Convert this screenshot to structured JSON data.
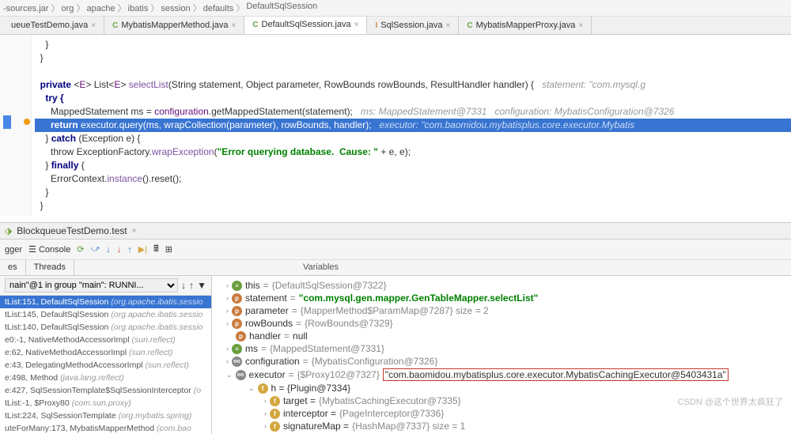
{
  "breadcrumb": [
    "-sources.jar",
    "org",
    "apache",
    "ibatis",
    "session",
    "defaults",
    "DefaultSqlSession"
  ],
  "tabs": [
    {
      "label": "ueueTestDemo.java",
      "iconClass": "",
      "active": false
    },
    {
      "label": "MybatisMapperMethod.java",
      "icon": "C",
      "iconClass": "",
      "active": false
    },
    {
      "label": "DefaultSqlSession.java",
      "icon": "C",
      "iconClass": "",
      "active": true
    },
    {
      "label": "SqlSession.java",
      "icon": "I",
      "iconClass": "orange",
      "active": false
    },
    {
      "label": "MybatisMapperProxy.java",
      "icon": "C",
      "iconClass": "",
      "active": false
    }
  ],
  "code": {
    "l1": "    }",
    "l2": "  }",
    "l3": "",
    "l4_pre": "  private <E> List<E> ",
    "l4_method": "selectList",
    "l4_args": "(String statement, Object parameter, RowBounds rowBounds, ResultHandler handler) {   ",
    "l4_com": "statement: \"com.mysql.g",
    "l5": "    try {",
    "l6_a": "      MappedStatement ms = ",
    "l6_b": "configuration",
    "l6_c": ".getMappedStatement(statement);   ",
    "l6_com": "ms: MappedStatement@7331   configuration: MybatisConfiguration@7326",
    "l7_a": "      return ",
    "l7_b": "executor",
    "l7_c": ".query(ms, ",
    "l7_d": "wrapCollection",
    "l7_e": "(parameter), rowBounds, handler);   ",
    "l7_com": "executor: \"com.baomidou.mybatisplus.core.executor.Mybatis",
    "l8_a": "    } ",
    "l8_b": "catch",
    "l8_c": " (Exception e) {",
    "l9_a": "      throw ExceptionFactory.",
    "l9_b": "wrapException",
    "l9_c": "(",
    "l9_str": "\"Error querying database.  Cause: \"",
    "l9_d": " + e, e);",
    "l10a": "    } ",
    "l10b": "finally",
    "l10c": " {",
    "l11_a": "      ErrorContext.",
    "l11_b": "instance",
    "l11_c": "().reset();",
    "l12": "    }",
    "l13": "  }"
  },
  "debugSession": "BlockqueueTestDemo.test",
  "debugTool": {
    "gger": "gger",
    "console": "Console"
  },
  "framesTabs": [
    "es",
    "Threads"
  ],
  "frameDropdown": "nain\"@1 in group \"main\": RUNNI...",
  "frames": [
    {
      "text": "tList:151, DefaultSqlSession ",
      "tail": "(org.apache.ibatis.sessio",
      "selected": true
    },
    {
      "text": "tList:145, DefaultSqlSession ",
      "tail": "(org.apache.ibatis.sessio"
    },
    {
      "text": "tList:140, DefaultSqlSession ",
      "tail": "(org.apache.ibatis.sessio"
    },
    {
      "text": "e0:-1, NativeMethodAccessorImpl ",
      "tail": "(sun.reflect)"
    },
    {
      "text": "e:62, NativeMethodAccessorImpl ",
      "tail": "(sun.reflect)"
    },
    {
      "text": "e:43, DelegatingMethodAccessorImpl ",
      "tail": "(sun.reflect)"
    },
    {
      "text": "e:498, Method ",
      "tail": "(java.lang.reflect)"
    },
    {
      "text": "e:427, SqlSessionTemplate$SqlSessionInterceptor ",
      "tail": "(o"
    },
    {
      "text": "tList:-1, $Proxy80 ",
      "tail": "(com.sun.proxy)"
    },
    {
      "text": "tList:224, SqlSessionTemplate ",
      "tail": "(org.mybatis.spring)"
    },
    {
      "text": "uteForMany:173, MybatisMapperMethod ",
      "tail": "(com.bao"
    }
  ],
  "varsTitle": "Variables",
  "vars": [
    {
      "icon": "this",
      "name": "this",
      "val": "{DefaultSqlSession@7322}"
    },
    {
      "icon": "p",
      "name": "statement",
      "val": "\"com.mysql.gen.mapper.GenTableMapper.selectList\"",
      "str": true
    },
    {
      "icon": "p",
      "name": "parameter",
      "val": "{MapperMethod$ParamMap@7287}  size = 2"
    },
    {
      "icon": "p",
      "name": "rowBounds",
      "val": "{RowBounds@7329}"
    },
    {
      "icon": "p",
      "name": "handler",
      "val": "null"
    },
    {
      "icon": "this",
      "name": "ms",
      "val": "{MappedStatement@7331}"
    },
    {
      "icon": "oo",
      "name": "configuration",
      "val": "{MybatisConfiguration@7326}"
    }
  ],
  "executor": {
    "name": "executor",
    "pre": "{$Proxy102@7327}",
    "box": "\"com.baomidou.mybatisplus.core.executor.MybatisCachingExecutor@5403431a\""
  },
  "executorChildren": {
    "h": "h = {Plugin@7334}",
    "target": "target = ",
    "targetVal": "{MybatisCachingExecutor@7335}",
    "interceptor": "interceptor = ",
    "interceptorVal": "{PageInterceptor@7336}",
    "sigMap": "signatureMap = ",
    "sigMapVal": "{HashMap@7337}  size = 1"
  },
  "watermark": "CSDN @这个世界太疯狂了"
}
